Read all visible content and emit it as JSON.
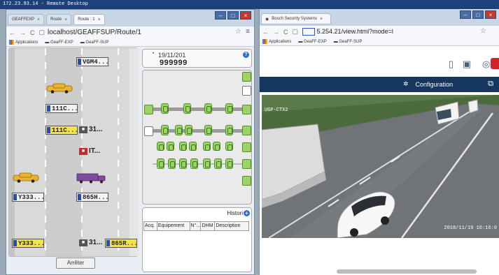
{
  "remote": {
    "title": "172.23.93.14 - Remote Desktop"
  },
  "left": {
    "tabs": [
      {
        "label": "GEAFFEXP",
        "active": false
      },
      {
        "label": "Route",
        "active": false
      },
      {
        "label": "Route : 1",
        "active": true
      }
    ],
    "url": "localhost/GEAFFSUP/Route/1",
    "bookmarks": [
      "Applications",
      "GeaFF-EXP",
      "GeaFF-SUP"
    ],
    "road": {
      "plates": [
        {
          "text": "VGM4...",
          "yellow": false
        },
        {
          "text": "111C...",
          "yellow": false
        },
        {
          "text": "111C...",
          "yellow": true
        },
        {
          "text": "Y333...",
          "yellow": false
        },
        {
          "text": "865H...",
          "yellow": false
        },
        {
          "text": "Y333...",
          "yellow": true
        },
        {
          "text": "865R...",
          "yellow": true
        }
      ],
      "counters": [
        {
          "value": "31...",
          "red": false
        },
        {
          "value": "IT...",
          "red": true
        },
        {
          "value": "31...",
          "red": false
        }
      ]
    },
    "stop_button": "Arrêter",
    "station": {
      "date": "19/11/201",
      "number": "999999"
    },
    "history": {
      "button": "Histori",
      "columns": [
        "Acq.",
        "Equipement",
        "N°...",
        "DHM",
        "Description"
      ]
    }
  },
  "right": {
    "tab": "Bosch Security Systems",
    "url_suffix": "5.254.21/view.html?mode=l",
    "bookmarks": [
      "Applications",
      "GeaFF-EXP",
      "GeaFF-SUP"
    ],
    "nav": {
      "configuration": "Configuration"
    },
    "video": {
      "label": "UGP-CTX2",
      "timestamp": "2018/11/19  16:16:0"
    }
  },
  "colors": {
    "accent_green": "#9ed36a",
    "nav_dark": "#15365f",
    "plate_yellow": "#f2e34a"
  }
}
